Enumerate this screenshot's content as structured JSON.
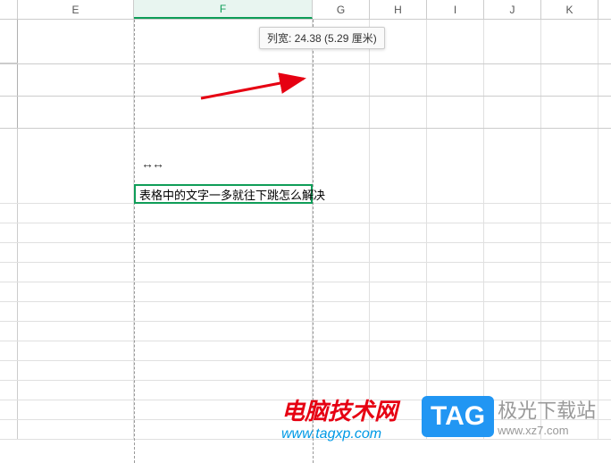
{
  "columns": [
    "E",
    "F",
    "G",
    "H",
    "I",
    "J",
    "K"
  ],
  "selected_column": "F",
  "tooltip": "列宽: 24.38 (5.29 厘米)",
  "cursor_symbol": "⇹ ⇹",
  "active_cell": {
    "text": "表格中的文字一多就往下跳怎么解决"
  },
  "watermark1": {
    "line1": "电脑技术网",
    "line2": "www.tagxp.com"
  },
  "watermark2": {
    "tag": "TAG",
    "text": "极光下载站",
    "url": "www.xz7.com"
  },
  "chart_data": {
    "type": "table",
    "title": "",
    "columns_visible": [
      "E",
      "F",
      "G",
      "H",
      "I",
      "J",
      "K"
    ],
    "selected_column": "F",
    "column_width_tooltip": {
      "label": "列宽",
      "value": 24.38,
      "cm": 5.29
    },
    "cells": [
      {
        "col": "F",
        "row_approx": 5,
        "value": "表格中的文字一多就往下跳怎么解决"
      }
    ]
  }
}
